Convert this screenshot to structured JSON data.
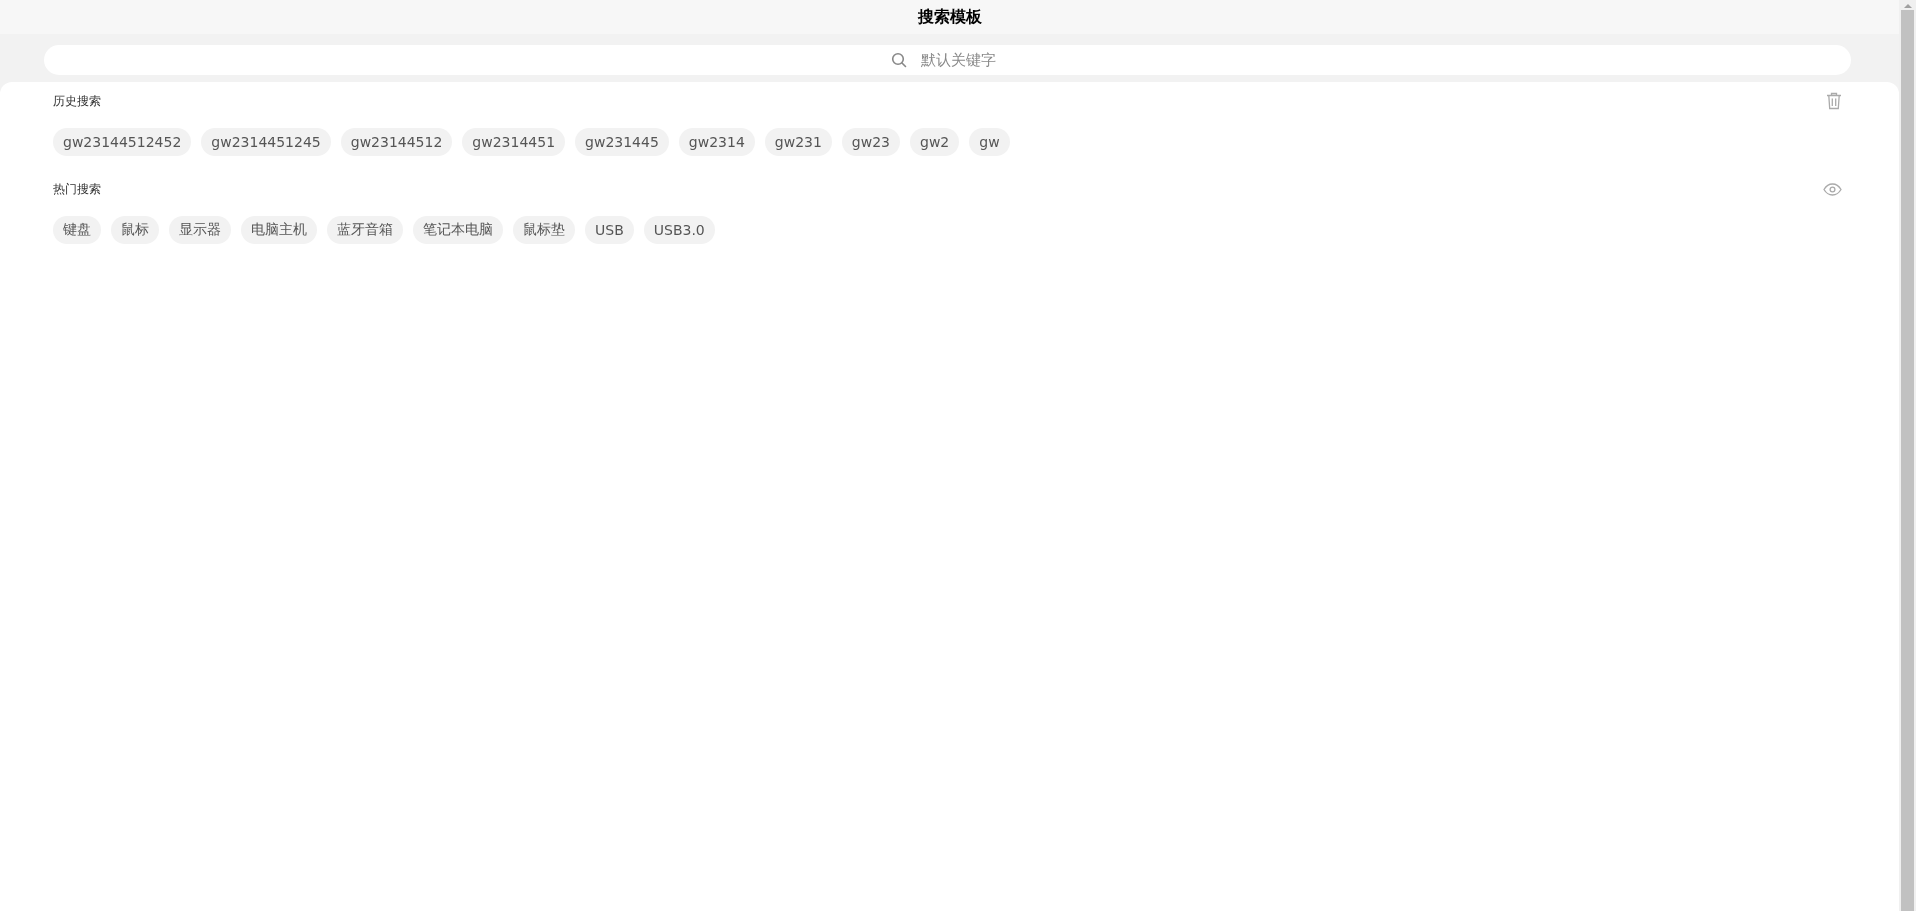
{
  "header": {
    "title": "搜索模板"
  },
  "search": {
    "placeholder": "默认关键字"
  },
  "sections": [
    {
      "title": "历史搜索",
      "kind": "delete",
      "tags": [
        "gw23144512452",
        "gw2314451245",
        "gw23144512",
        "gw2314451",
        "gw231445",
        "gw2314",
        "gw231",
        "gw23",
        "gw2",
        "gw"
      ]
    },
    {
      "title": "热门搜索",
      "kind": "visibility",
      "tags": [
        "键盘",
        "鼠标",
        "显示器",
        "电脑主机",
        "蓝牙音箱",
        "笔记本电脑",
        "鼠标垫",
        "USB",
        "USB3.0"
      ]
    }
  ]
}
